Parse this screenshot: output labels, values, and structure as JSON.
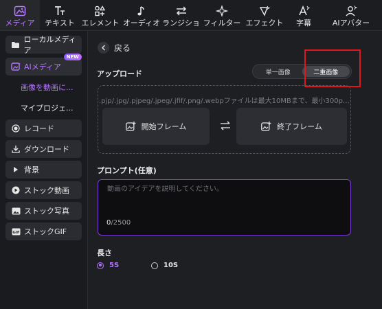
{
  "toolbar": {
    "items": [
      {
        "label": "メディア",
        "icon": "media-icon"
      },
      {
        "label": "テキスト",
        "icon": "text-icon"
      },
      {
        "label": "エレメント",
        "icon": "elements-icon"
      },
      {
        "label": "オーディオ",
        "icon": "audio-icon"
      },
      {
        "label": "トランジション",
        "icon": "transition-icon"
      },
      {
        "label": "フィルター",
        "icon": "filter-icon"
      },
      {
        "label": "エフェクト",
        "icon": "effect-icon"
      },
      {
        "label": "字幕",
        "icon": "subtitle-icon"
      },
      {
        "label": "AIアバター",
        "icon": "avatar-icon"
      }
    ]
  },
  "sidebar": {
    "local_media": "ローカルメディア",
    "ai_media": "AIメディア",
    "new_badge": "NEW",
    "sub_image_to_video": "画像を動画に...",
    "sub_my_project": "マイプロジェ...",
    "record": "レコード",
    "download": "ダウンロード",
    "background": "背景",
    "stock_video": "ストック動画",
    "stock_photo": "ストック写真",
    "stock_gif": "ストックGIF"
  },
  "main": {
    "back": "戻る",
    "upload_title": "アップロード",
    "mode_single": "単一画像",
    "mode_double": "二重画像",
    "upload_hint": ".pjp/.jpg/.pjpeg/.jpeg/.jfif/.png/.webpファイルは最大10MBまで、最小300px...",
    "start_frame": "開始フレーム",
    "end_frame": "終了フレーム",
    "prompt_title": "プロンプト(任意)",
    "prompt_placeholder": "動画のアイデアを説明してください。",
    "prompt_count": "0",
    "prompt_max": "/2500",
    "length_title": "長さ",
    "length_5": "5S",
    "length_10": "10S"
  },
  "colors": {
    "accent": "#b477ff",
    "highlight": "#e3161b"
  }
}
